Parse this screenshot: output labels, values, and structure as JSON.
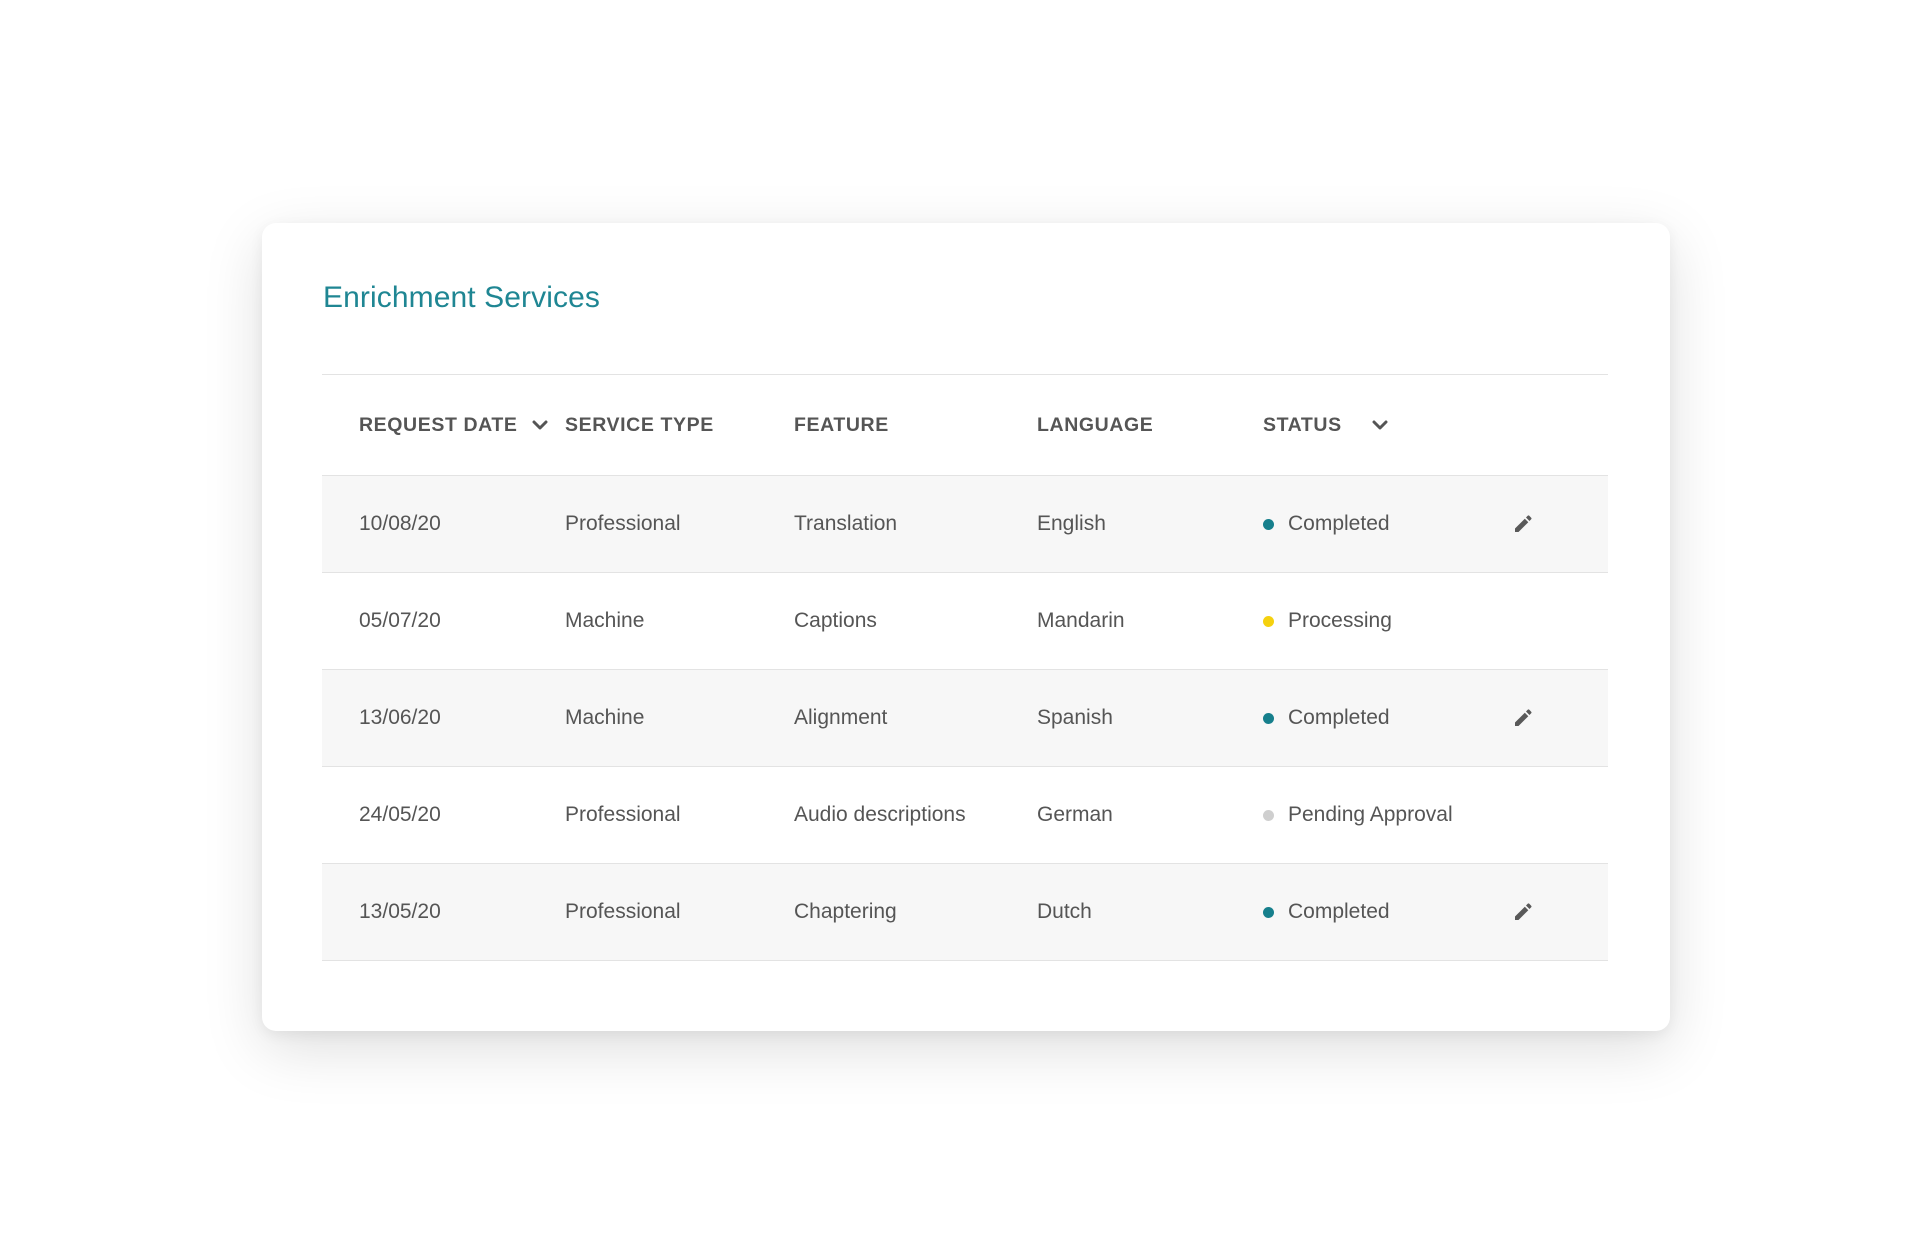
{
  "card": {
    "title": "Enrichment Services"
  },
  "table": {
    "headers": {
      "request_date": "REQUEST DATE",
      "service_type": "SERVICE TYPE",
      "feature": "FEATURE",
      "language": "LANGUAGE",
      "status": "STATUS"
    },
    "rows": [
      {
        "date": "10/08/20",
        "service": "Professional",
        "feature": "Translation",
        "language": "English",
        "status": "Completed",
        "status_color": "#167f8c",
        "editable": true
      },
      {
        "date": "05/07/20",
        "service": "Machine",
        "feature": "Captions",
        "language": "Mandarin",
        "status": "Processing",
        "status_color": "#f5d10f",
        "editable": false
      },
      {
        "date": "13/06/20",
        "service": "Machine",
        "feature": "Alignment",
        "language": "Spanish",
        "status": "Completed",
        "status_color": "#167f8c",
        "editable": true
      },
      {
        "date": "24/05/20",
        "service": "Professional",
        "feature": "Audio descriptions",
        "language": "German",
        "status": "Pending Approval",
        "status_color": "#cfcfcf",
        "editable": false
      },
      {
        "date": "13/05/20",
        "service": "Professional",
        "feature": "Chaptering",
        "language": "Dutch",
        "status": "Completed",
        "status_color": "#167f8c",
        "editable": true
      }
    ]
  },
  "icons": {
    "sort": "chevron-down-icon",
    "edit": "pencil-icon"
  },
  "colors": {
    "title": "#1f8693",
    "completed": "#167f8c",
    "processing": "#f5d10f",
    "pending": "#cfcfcf",
    "row_shade": "#f7f7f7"
  }
}
